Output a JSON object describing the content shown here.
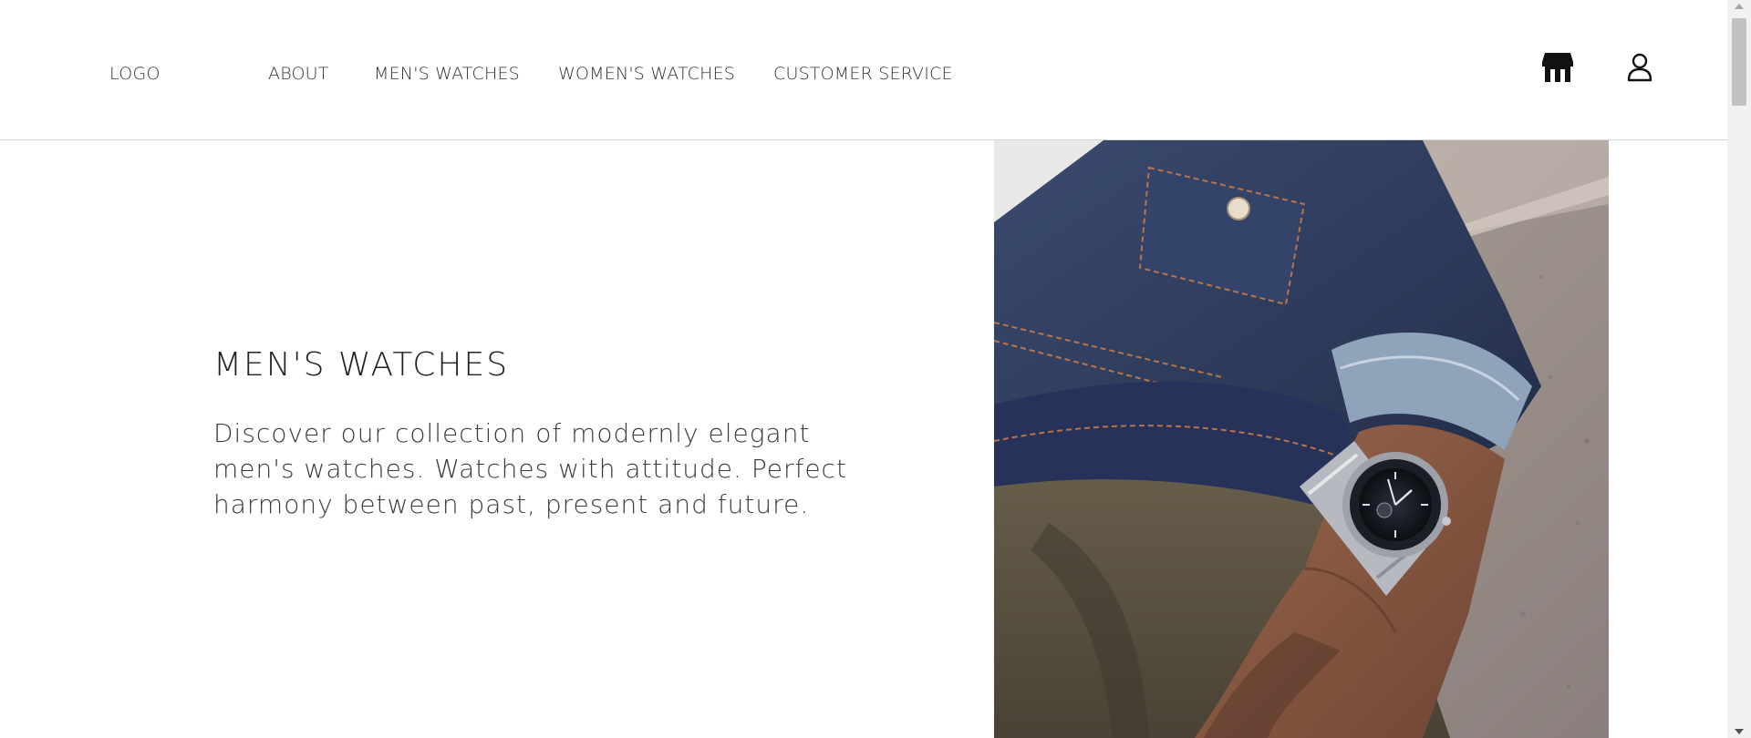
{
  "header": {
    "logo": "LOGO",
    "nav": {
      "about": "ABOUT",
      "mens": "MEN'S WATCHES",
      "womens": "WOMEN'S WATCHES",
      "service": "CUSTOMER SERVICE"
    },
    "icons": {
      "store": "store-icon",
      "user": "user-icon"
    }
  },
  "hero": {
    "title": "MEN'S WATCHES",
    "description": "Discover our collection of modernly elegant men's watches. Watches with attitude. Perfect harmony between past, present and future."
  },
  "colors": {
    "text": "#222222",
    "divider": "#d7d7d7",
    "denim": "#2f3d5e",
    "trousers": "#5f5646",
    "skin": "#8a5a44",
    "granite": "#a79c96"
  }
}
